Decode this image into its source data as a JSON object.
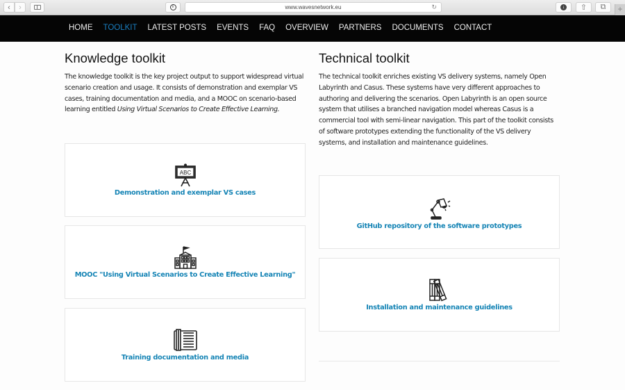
{
  "browser": {
    "url": "www.wavesnetwork.eu",
    "icons": {
      "back": "chevron-left-icon",
      "forward": "chevron-right-icon",
      "sidebar": "sidebar-icon",
      "info": "info-icon",
      "reload": "reload-icon",
      "download": "download-icon",
      "share": "share-icon",
      "tabs": "tabs-icon",
      "new_tab": "plus-icon"
    },
    "glyphs": {
      "back": "‹",
      "forward": "›",
      "info": "i",
      "reload": "↻",
      "download": "↓",
      "share": "⇧",
      "tabs": "⧉",
      "new_tab": "+"
    }
  },
  "nav": {
    "items": [
      {
        "label": "HOME",
        "active": false
      },
      {
        "label": "TOOLKIT",
        "active": true
      },
      {
        "label": "LATEST POSTS",
        "active": false
      },
      {
        "label": "EVENTS",
        "active": false
      },
      {
        "label": "FAQ",
        "active": false
      },
      {
        "label": "OVERVIEW",
        "active": false
      },
      {
        "label": "PARTNERS",
        "active": false
      },
      {
        "label": "DOCUMENTS",
        "active": false
      },
      {
        "label": "CONTACT",
        "active": false
      }
    ],
    "active_color": "#1a7fc1"
  },
  "knowledge": {
    "title": "Knowledge toolkit",
    "intro_text": "The knowledge toolkit is the key project output to support widespread virtual scenario creation and usage. It consists of demonstration and exemplar VS cases, training documentation and media, and a MOOC on scenario-based learning entitled ",
    "intro_italic": "Using Virtual Scenarios to Create Effective Learning.",
    "cards": [
      {
        "label": "Demonstration and exemplar VS cases",
        "icon": "chalkboard-icon"
      },
      {
        "label": "MOOC \"Using Virtual Scenarios to Create Effective Learning\"",
        "icon": "school-building-icon"
      },
      {
        "label": "Training documentation and media",
        "icon": "open-book-icon"
      }
    ]
  },
  "technical": {
    "title": "Technical toolkit",
    "intro_text": "The technical toolkit enriches existing VS delivery systems, namely Open Labyrinth and Casus. These systems have very different approaches to authoring and delivering the scenarios. Open Labyrinth is an open source system that utilises a branched navigation model whereas Casus is a commercial tool with semi-linear navigation. This part of the toolkit consists of software prototypes extending the functionality of the VS delivery systems, and installation and maintenance guidelines.",
    "cards": [
      {
        "label": "GitHub repository of the software prototypes",
        "icon": "desk-lamp-icon"
      },
      {
        "label": "Installation and maintenance guidelines",
        "icon": "books-icon"
      }
    ]
  },
  "colors": {
    "link": "#1584b5",
    "nav_bg": "#050505"
  }
}
